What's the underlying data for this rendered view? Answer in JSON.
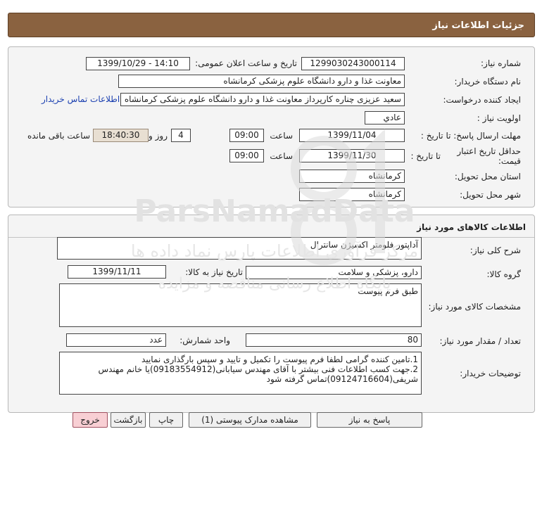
{
  "header": {
    "title": "جزئیات اطلاعات نیاز"
  },
  "info": {
    "need_number_label": "شماره نیاز:",
    "need_number": "1299030243000114",
    "announce_label": "تاریخ و ساعت اعلان عمومی:",
    "announce_value": "1399/10/29 - 14:10",
    "buyer_org_label": "نام دستگاه خریدار:",
    "buyer_org": "معاونت غذا و دارو دانشگاه علوم پزشکی کرمانشاه",
    "requester_label": "ایجاد کننده درخواست:",
    "requester": "سعید عزیزی چناره کارپرداز معاونت غذا و دارو دانشگاه علوم پزشکی کرمانشاه",
    "contact_link": "اطلاعات تماس خریدار",
    "priority_label": "اولویت نیاز :",
    "priority": "عادي",
    "reply_deadline_label": "مهلت ارسال پاسخ: تا تاریخ :",
    "reply_date": "1399/11/04",
    "time_label": "ساعت",
    "reply_time": "09:00",
    "days_value": "4",
    "days_label": "روز و",
    "remaining_time": "18:40:30",
    "remaining_label": "ساعت باقی مانده",
    "validity_label": "حداقل تاریخ اعتبار قیمت:",
    "validity_to_label": "تا تاریخ :",
    "validity_date": "1399/11/30",
    "validity_time_label": "ساعت",
    "validity_time": "09:00",
    "province_label": "استان محل تحویل:",
    "province": "کرمانشاه",
    "city_label": "شهر محل تحویل:",
    "city": "کرمانشاه"
  },
  "goods": {
    "section_title": "اطلاعات کالاهای مورد نیاز",
    "summary_label": "شرح کلی نیاز:",
    "summary": "آداپتور فلومتر اکسیژن سانترال",
    "group_label": "گروه کالا:",
    "group": "دارو، پزشکی و سلامت",
    "need_date_label": "تاریخ نیاز به کالا:",
    "need_date": "1399/11/11",
    "specs_label": "مشخصات کالای مورد نیاز:",
    "specs": "طبق فرم پیوست",
    "qty_label": "تعداد / مقدار مورد نیاز:",
    "qty": "80",
    "unit_label": "واحد شمارش:",
    "unit": "عدد",
    "notes_label": "توضیحات خریدار:",
    "notes_line1": "1.تامین کننده گرامی لطفا فرم پیوست را تکمیل و تایید و سپس بارگذاری نمایید",
    "notes_line2": "2.جهت کسب اطلاعات فنی بیشتر با آقای مهندس سیابانی(09183554912)یا خانم مهندس شریفی(09124716604)تماس گرفته شود"
  },
  "buttons": {
    "reply": "پاسخ به نیاز",
    "attachments": "مشاهده مدارک پیوستی (1)",
    "print": "چاپ",
    "back": "بازگشت",
    "exit": "خروج"
  },
  "watermark": {
    "brand": "ParsNamadData",
    "line1": "مرکز فرآوری اطلاعات پارس نماد داده ها",
    "line2": "پایگاه اطلاع رسانی مناقصه و مزایده"
  }
}
